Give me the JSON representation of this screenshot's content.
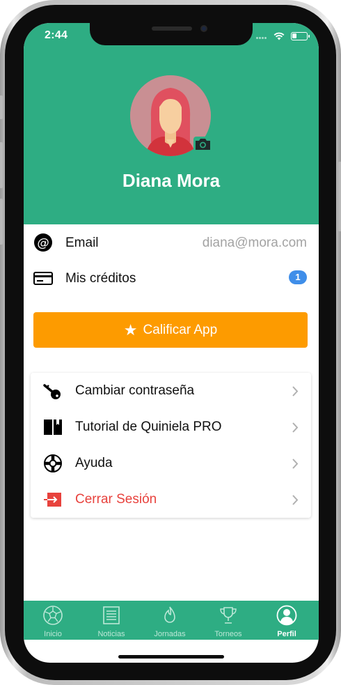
{
  "status": {
    "time": "2:44"
  },
  "profile": {
    "name": "Diana Mora"
  },
  "info": {
    "email_label": "Email",
    "email_value": "diana@mora.com",
    "credits_label": "Mis créditos",
    "credits_count": "1"
  },
  "rate_button": {
    "label": "Calificar App",
    "icon": "star-icon"
  },
  "menu": {
    "items": [
      {
        "label": "Cambiar contraseña",
        "icon": "key-icon"
      },
      {
        "label": "Tutorial de Quiniela PRO",
        "icon": "book-icon"
      },
      {
        "label": "Ayuda",
        "icon": "lifebuoy-icon"
      },
      {
        "label": "Cerrar Sesión",
        "icon": "logout-icon"
      }
    ]
  },
  "tabs": [
    {
      "label": "Inicio",
      "icon": "soccer-ball-icon",
      "active": false
    },
    {
      "label": "Noticias",
      "icon": "newspaper-icon",
      "active": false
    },
    {
      "label": "Jornadas",
      "icon": "flame-icon",
      "active": false
    },
    {
      "label": "Torneos",
      "icon": "trophy-icon",
      "active": false
    },
    {
      "label": "Perfil",
      "icon": "user-icon",
      "active": true
    }
  ],
  "colors": {
    "primary": "#2ead83",
    "accent": "#fd9b00",
    "badge": "#3f8ee9",
    "danger": "#e8423d"
  }
}
